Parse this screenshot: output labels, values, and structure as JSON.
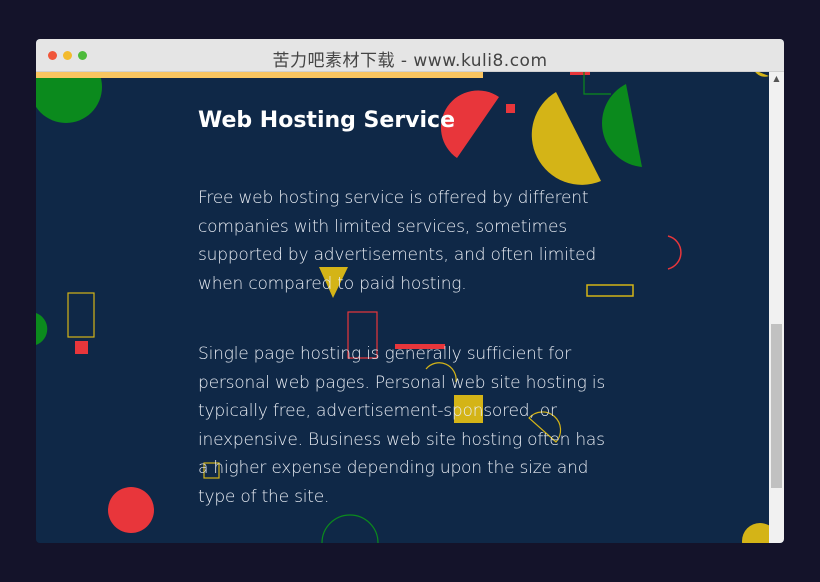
{
  "window": {
    "title": "苦力吧素材下载 - www.kuli8.com",
    "controls": [
      "close",
      "minimize",
      "maximize"
    ]
  },
  "reading_progress": {
    "fraction": 0.61,
    "color": "#f9c560"
  },
  "article": {
    "heading": "Web Hosting Service",
    "paragraphs": [
      "Free web hosting service is offered by different companies with limited services, sometimes supported by advertisements, and often limited when compared to paid hosting.",
      "Single page hosting is generally sufficient for personal web pages. Personal web site hosting is typically free, advertisement-sponsored, or inexpensive. Business web site hosting often has a higher expense depending upon the size and type of the site."
    ]
  },
  "scrollbar": {
    "up_arrow": "▲",
    "thumb_start_fraction": 0.52,
    "thumb_size_fraction": 0.36
  },
  "colors": {
    "background": "#0f2847",
    "text": "#e8ecf3",
    "shape_red": "#e8363b",
    "shape_yellow": "#d4b417",
    "shape_green": "#0b8a1d"
  }
}
